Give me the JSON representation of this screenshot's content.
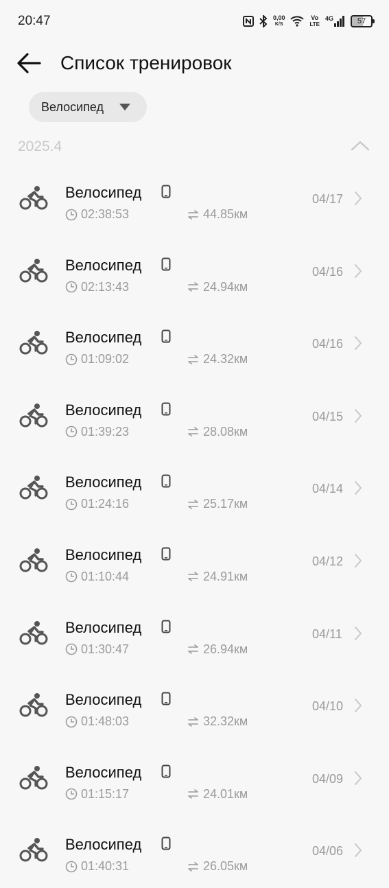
{
  "status": {
    "time": "20:47",
    "speed_value": "0,00",
    "speed_unit": "K/S",
    "volte_top": "Vo",
    "volte_bottom": "LTE",
    "network": "4G",
    "battery": "57"
  },
  "header": {
    "title": "Список тренировок"
  },
  "filter": {
    "selected": "Велосипед"
  },
  "group": {
    "title": "2025.4"
  },
  "workouts": [
    {
      "name": "Велосипед",
      "duration": "02:38:53",
      "distance": "44.85км",
      "date": "04/17"
    },
    {
      "name": "Велосипед",
      "duration": "02:13:43",
      "distance": "24.94км",
      "date": "04/16"
    },
    {
      "name": "Велосипед",
      "duration": "01:09:02",
      "distance": "24.32км",
      "date": "04/16"
    },
    {
      "name": "Велосипед",
      "duration": "01:39:23",
      "distance": "28.08км",
      "date": "04/15"
    },
    {
      "name": "Велосипед",
      "duration": "01:24:16",
      "distance": "25.17км",
      "date": "04/14"
    },
    {
      "name": "Велосипед",
      "duration": "01:10:44",
      "distance": "24.91км",
      "date": "04/12"
    },
    {
      "name": "Велосипед",
      "duration": "01:30:47",
      "distance": "26.94км",
      "date": "04/11"
    },
    {
      "name": "Велосипед",
      "duration": "01:48:03",
      "distance": "32.32км",
      "date": "04/10"
    },
    {
      "name": "Велосипед",
      "duration": "01:15:17",
      "distance": "24.01км",
      "date": "04/09"
    },
    {
      "name": "Велосипед",
      "duration": "01:40:31",
      "distance": "26.05км",
      "date": "04/06"
    }
  ],
  "icons": {
    "row_icon": "bicycle-icon",
    "source_icon": "phone-icon",
    "duration_icon": "clock-icon",
    "distance_icon": "swap-arrows-icon"
  }
}
